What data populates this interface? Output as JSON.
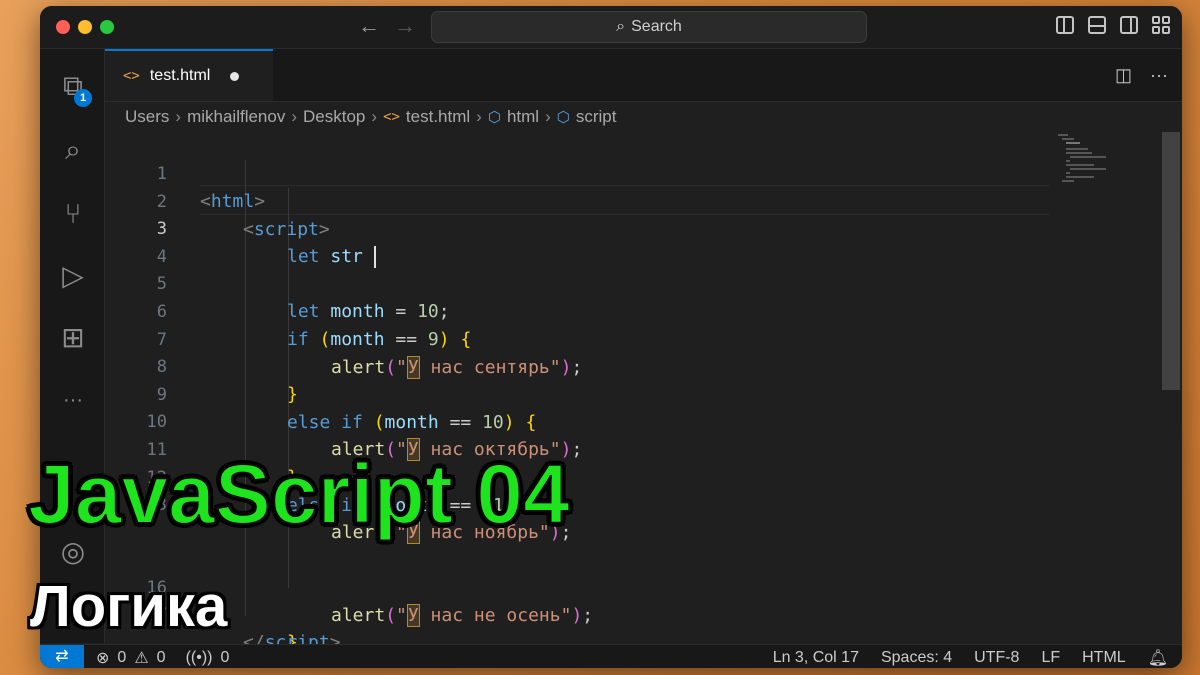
{
  "titlebar": {
    "back_icon": "arrow-left-icon",
    "forward_icon": "arrow-right-icon",
    "search_label": "Search"
  },
  "activity": {
    "explorer_badge": "1",
    "more_label": "···"
  },
  "tab": {
    "label": "test.html",
    "icon": "<>"
  },
  "breadcrumb": {
    "items": [
      "Users",
      "mikhailflenov",
      "Desktop",
      "test.html",
      "html",
      "script"
    ]
  },
  "editor": {
    "lines": [
      {
        "n": "1"
      },
      {
        "n": "2"
      },
      {
        "n": "3"
      },
      {
        "n": "4"
      },
      {
        "n": "5"
      },
      {
        "n": "6"
      },
      {
        "n": "7"
      },
      {
        "n": "8"
      },
      {
        "n": "9"
      },
      {
        "n": "10"
      },
      {
        "n": "11"
      },
      {
        "n": "12"
      },
      {
        "n": "13"
      },
      {
        "n": "16"
      },
      {
        "n": "17"
      }
    ],
    "tokens": {
      "html_open": "html",
      "script_open": "script",
      "let": "let",
      "str": "str",
      "month": "month",
      "eq": " = ",
      "ten": "10",
      "if": "if",
      "else_if": "else if",
      "cmp": " == ",
      "nine": "9",
      "eleven": "11",
      "alert": "alert",
      "s_sep": "У",
      "s_sep_rest": " нас сентярь\"",
      "s_oct_rest": " нас октябрь\"",
      "s_nov_rest": " нас ноябрь\"",
      "s_else_rest": " нас не осень\"",
      "script_close_text": "script"
    }
  },
  "statusbar": {
    "errors": "0",
    "warnings": "0",
    "ports": "0",
    "position": "Ln 3, Col 17",
    "spaces": "Spaces: 4",
    "encoding": "UTF-8",
    "eol": "LF",
    "language": "HTML"
  },
  "overlay": {
    "title": "JavaScript 04",
    "subtitle": "Логика"
  }
}
